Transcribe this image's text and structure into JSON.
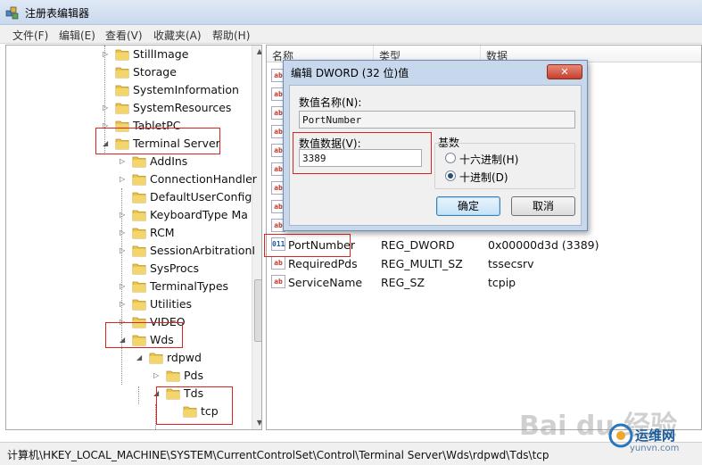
{
  "window": {
    "title": "注册表编辑器"
  },
  "menu": [
    "文件(F)",
    "编辑(E)",
    "查看(V)",
    "收藏夹(A)",
    "帮助(H)"
  ],
  "tree": [
    {
      "label": "StillImage",
      "depth": 1,
      "expander": "right"
    },
    {
      "label": "Storage",
      "depth": 1,
      "expander": "none"
    },
    {
      "label": "SystemInformation",
      "depth": 1,
      "expander": "none"
    },
    {
      "label": "SystemResources",
      "depth": 1,
      "expander": "right"
    },
    {
      "label": "TabletPC",
      "depth": 1,
      "expander": "right"
    },
    {
      "label": "Terminal Server",
      "depth": 1,
      "expander": "down"
    },
    {
      "label": "AddIns",
      "depth": 2,
      "expander": "right"
    },
    {
      "label": "ConnectionHandler",
      "depth": 2,
      "expander": "right"
    },
    {
      "label": "DefaultUserConfig",
      "depth": 2,
      "expander": "none"
    },
    {
      "label": "KeyboardType Ma",
      "depth": 2,
      "expander": "right"
    },
    {
      "label": "RCM",
      "depth": 2,
      "expander": "right"
    },
    {
      "label": "SessionArbitrationI",
      "depth": 2,
      "expander": "right"
    },
    {
      "label": "SysProcs",
      "depth": 2,
      "expander": "none"
    },
    {
      "label": "TerminalTypes",
      "depth": 2,
      "expander": "right"
    },
    {
      "label": "Utilities",
      "depth": 2,
      "expander": "right"
    },
    {
      "label": "VIDEO",
      "depth": 2,
      "expander": "right"
    },
    {
      "label": "Wds",
      "depth": 2,
      "expander": "down"
    },
    {
      "label": "rdpwd",
      "depth": 3,
      "expander": "down"
    },
    {
      "label": "Pds",
      "depth": 4,
      "expander": "right"
    },
    {
      "label": "Tds",
      "depth": 4,
      "expander": "down"
    },
    {
      "label": "tcp",
      "depth": 5,
      "expander": "none"
    }
  ],
  "columns": [
    "名称",
    "类型",
    "数据"
  ],
  "values": [
    {
      "name": "PortNumber",
      "type": "REG_DWORD",
      "data": "0x00000d3d (3389)",
      "icon": "bin"
    },
    {
      "name": "RequiredPds",
      "type": "REG_MULTI_SZ",
      "data": "tssecsrv",
      "icon": "ab"
    },
    {
      "name": "ServiceName",
      "type": "REG_SZ",
      "data": "tcpip",
      "icon": "ab"
    }
  ],
  "dialog": {
    "title": "编辑 DWORD (32 位)值",
    "close_label": "✕",
    "name_label": "数值名称(N):",
    "name_value": "PortNumber",
    "data_label": "数值数据(V):",
    "data_value": "3389",
    "base_label": "基数",
    "hex_label": "十六进制(H)",
    "dec_label": "十进制(D)",
    "selected_base": "dec",
    "ok_label": "确定",
    "cancel_label": "取消"
  },
  "status": {
    "path": "计算机\\HKEY_LOCAL_MACHINE\\SYSTEM\\CurrentControlSet\\Control\\Terminal Server\\Wds\\rdpwd\\Tds\\tcp"
  },
  "watermark": {
    "text": "Bai du 经验"
  },
  "brand": {
    "name": "运维网",
    "url": "yunvn.com"
  },
  "colors": {
    "highlight": "#dd2222",
    "folder": "#e9c44a",
    "dialog_frame": "#c7d8ec"
  }
}
